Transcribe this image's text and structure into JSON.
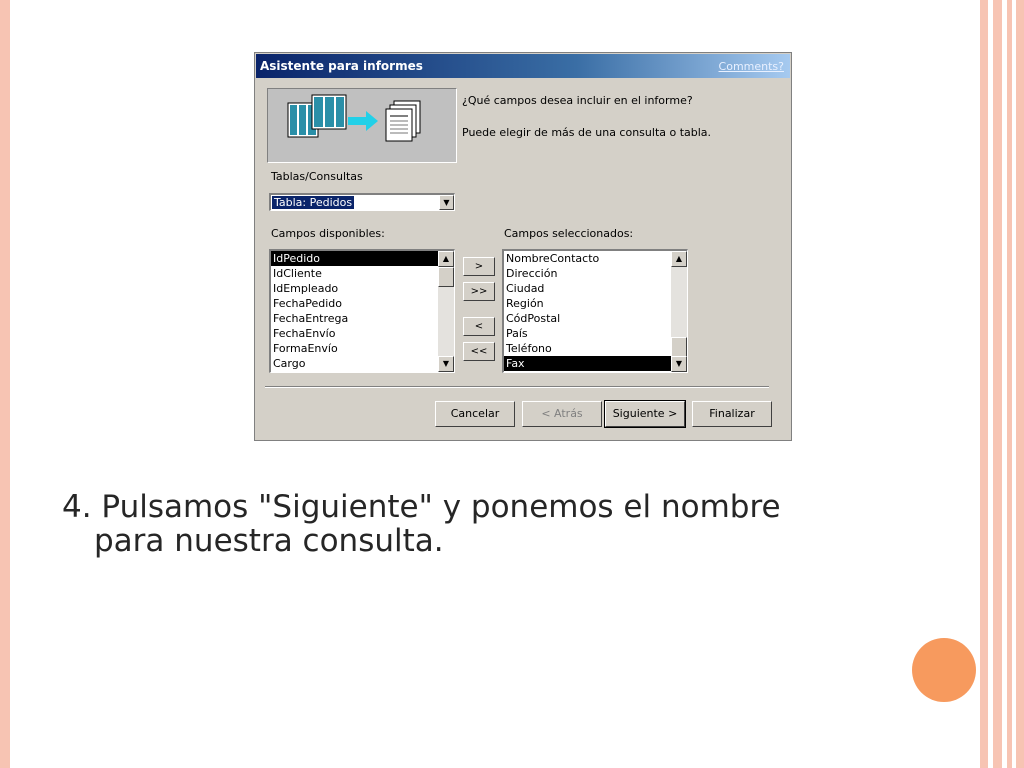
{
  "dialog": {
    "title": "Asistente para informes",
    "comments_link": "Comments?",
    "question": "¿Qué campos desea incluir en el informe?",
    "hint": "Puede elegir de más de una consulta o tabla.",
    "tables_label": "Tablas/Consultas",
    "table_select": "Tabla: Pedidos",
    "available_label": "Campos disponibles:",
    "selected_label": "Campos seleccionados:",
    "available_fields": [
      "IdPedido",
      "IdCliente",
      "IdEmpleado",
      "FechaPedido",
      "FechaEntrega",
      "FechaEnvío",
      "FormaEnvío",
      "Cargo"
    ],
    "selected_fields": [
      "NombreContacto",
      "Dirección",
      "Ciudad",
      "Región",
      "CódPostal",
      "País",
      "Teléfono",
      "Fax"
    ],
    "move_buttons": {
      "add_one": ">",
      "add_all": ">>",
      "remove_one": "<",
      "remove_all": "<<"
    },
    "buttons": {
      "cancel": "Cancelar",
      "back": "< Atrás",
      "next": "Siguiente >",
      "finish": "Finalizar"
    }
  },
  "caption": {
    "line1": "4. Pulsamos \"Siguiente\" y ponemos el nombre",
    "line2": "para nuestra consulta."
  },
  "colors": {
    "accent_circle": "#f79a5e",
    "slide_border": "#f7c4b3"
  }
}
